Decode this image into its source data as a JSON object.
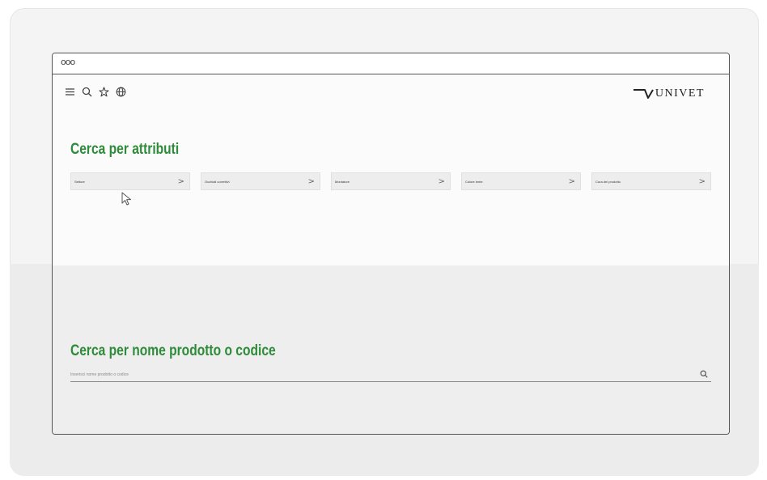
{
  "window": {
    "dots": "ooo"
  },
  "toolbar": {
    "icons": [
      "menu-icon",
      "search-icon",
      "star-icon",
      "globe-icon"
    ]
  },
  "brand": {
    "name": "UNIVET"
  },
  "attributes_section": {
    "title": "Cerca per attributi",
    "buttons": [
      {
        "label": "Settore",
        "chevron": ">"
      },
      {
        "label": "Occhiali correttivi",
        "chevron": ">"
      },
      {
        "label": "Montature",
        "chevron": ">"
      },
      {
        "label": "Colore lente",
        "chevron": ">"
      },
      {
        "label": "Cura del prodotto",
        "chevron": ">"
      }
    ]
  },
  "search_section": {
    "title": "Cerca per nome prodotto o codice",
    "placeholder": "Inserisci nome prodotto o codice"
  },
  "colors": {
    "accent_green": "#2e8b3a",
    "frame_border": "#555555"
  }
}
